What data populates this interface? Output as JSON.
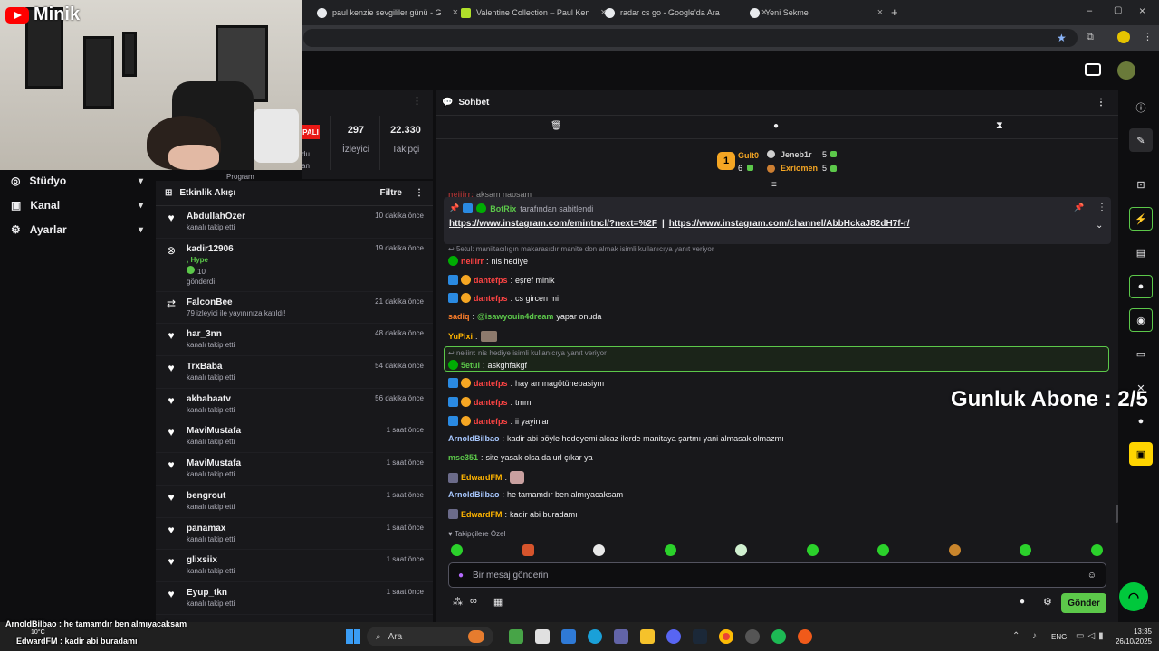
{
  "browser": {
    "tabs": [
      {
        "label": "paul kenzie sevgililer günü - G"
      },
      {
        "label": "Valentine Collection – Paul Ken"
      },
      {
        "label": "radar cs go - Google'da Ara"
      },
      {
        "label": "Yeni Sekme"
      }
    ]
  },
  "youtube": {
    "name": "Minik"
  },
  "stats": {
    "live_badge": "PALI",
    "cut_text_1": "du",
    "cut_text_2": "an",
    "viewers_value": "297",
    "viewers_label": "İzleyici",
    "followers_value": "22.330",
    "followers_label": "Takipçi",
    "program_label": "Program"
  },
  "sidebar": {
    "items": [
      {
        "label": "Stüdyo"
      },
      {
        "label": "Kanal"
      },
      {
        "label": "Ayarlar"
      }
    ]
  },
  "feed": {
    "title": "Etkinlik Akışı",
    "filter": "Filtre",
    "items": [
      {
        "name": "AbdullahOzer",
        "sub": "kanalı takip etti",
        "time": "10 dakika önce"
      },
      {
        "name": "kadir12906",
        "sub": ", Hype",
        "sub2": "10",
        "sub3": "gönderdi",
        "time": "19 dakika önce"
      },
      {
        "name": "FalconBee",
        "sub": "79 izleyici ile yayınınıza katıldı!",
        "time": "21 dakika önce"
      },
      {
        "name": "har_3nn",
        "sub": "kanalı takip etti",
        "time": "48 dakika önce"
      },
      {
        "name": "TrxBaba",
        "sub": "kanalı takip etti",
        "time": "54 dakika önce"
      },
      {
        "name": "akbabaatv",
        "sub": "kanalı takip etti",
        "time": "56 dakika önce"
      },
      {
        "name": "MaviMustafa",
        "sub": "kanalı takip etti",
        "time": "1 saat önce"
      },
      {
        "name": "MaviMustafa",
        "sub": "kanalı takip etti",
        "time": "1 saat önce"
      },
      {
        "name": "bengrout",
        "sub": "kanalı takip etti",
        "time": "1 saat önce"
      },
      {
        "name": "panamax",
        "sub": "kanalı takip etti",
        "time": "1 saat önce"
      },
      {
        "name": "glixsiix",
        "sub": "kanalı takip etti",
        "time": "1 saat önce"
      },
      {
        "name": "Eyup_tkn",
        "sub": "kanalı takip etti",
        "time": "1 saat önce"
      }
    ]
  },
  "chat": {
    "title": "Sohbet",
    "leaderboard": {
      "first_name": "Gult0",
      "first_count": "6",
      "second_name": "Jeneb1r",
      "second_count": "5",
      "third_name": "Exriomen",
      "third_count": "5"
    },
    "partial_msg": "aksam napsam",
    "pinned": {
      "by_user": "BotRix",
      "by_text": "tarafından sabitlendi",
      "link1": "https://www.instagram.com/emintncl/?next=%2F",
      "sep": "|",
      "link2": "https://www.instagram.com/channel/AbbHckaJ82dH7f-r/"
    },
    "messages": [
      {
        "reply": "5etul: maniitacılıgın makarasıdır manite don almak isimli kullanıcıya yanıt veriyor"
      },
      {
        "user": "neiiirr",
        "text": "nis hediye",
        "color": "#ff4444"
      },
      {
        "user": "dantefps",
        "text": "eşref minik",
        "color": "#ff4444"
      },
      {
        "user": "dantefps",
        "text": "cs gircen mi",
        "color": "#ff4444"
      },
      {
        "user": "sadiq",
        "mention": "@isawyouin4dream",
        "text": "yapar onuda",
        "color": "#ff7f2a"
      },
      {
        "user": "YuPixi",
        "text": "",
        "color": "#ffb400"
      },
      {
        "reply": "neiiirr: nis hediye isimli kullanıcıya yanıt veriyor"
      },
      {
        "user": "5etul",
        "text": "askghfakgf",
        "color": "#5cc84a"
      },
      {
        "user": "dantefps",
        "text": "hay amınagötünebasiym",
        "color": "#ff4444"
      },
      {
        "user": "dantefps",
        "text": "tmm",
        "color": "#ff4444"
      },
      {
        "user": "dantefps",
        "text": "ii yayinlar",
        "color": "#ff4444"
      },
      {
        "user": "ArnoldBilbao",
        "text": "kadir abi böyle hedeyemi alcaz ilerde manitaya şartmı yani almasak olmazmı",
        "color": "#a8c8ff"
      },
      {
        "user": "mse351",
        "text": "site yasak olsa da url çıkar ya",
        "color": "#5cc84a"
      },
      {
        "user": "EdwardFM",
        "text": "",
        "color": "#ffb400"
      },
      {
        "user": "ArnoldBilbao",
        "text": "he tamamdır ben almıyacaksam",
        "color": "#a8c8ff"
      },
      {
        "user": "EdwardFM",
        "text": "kadir abi buradamı",
        "color": "#ffb400"
      }
    ],
    "followers_only": "Takipçilere Özel",
    "input_placeholder": "Bir mesaj gönderin",
    "send_label": "Gönder",
    "infinity": "∞"
  },
  "overlay": {
    "goal": "Gunluk Abone : 2/5",
    "chat1_user": "ArnoldBilbao",
    "chat1_text": ": he tamamdır ben almıyacaksam",
    "chat2_user": "EdwardFM",
    "chat2_text": ": kadir abi buradamı",
    "temp": "10°C"
  },
  "taskbar": {
    "search": "Ara",
    "lang": "ENG",
    "time": "13:35",
    "date": "26/10/2025"
  }
}
